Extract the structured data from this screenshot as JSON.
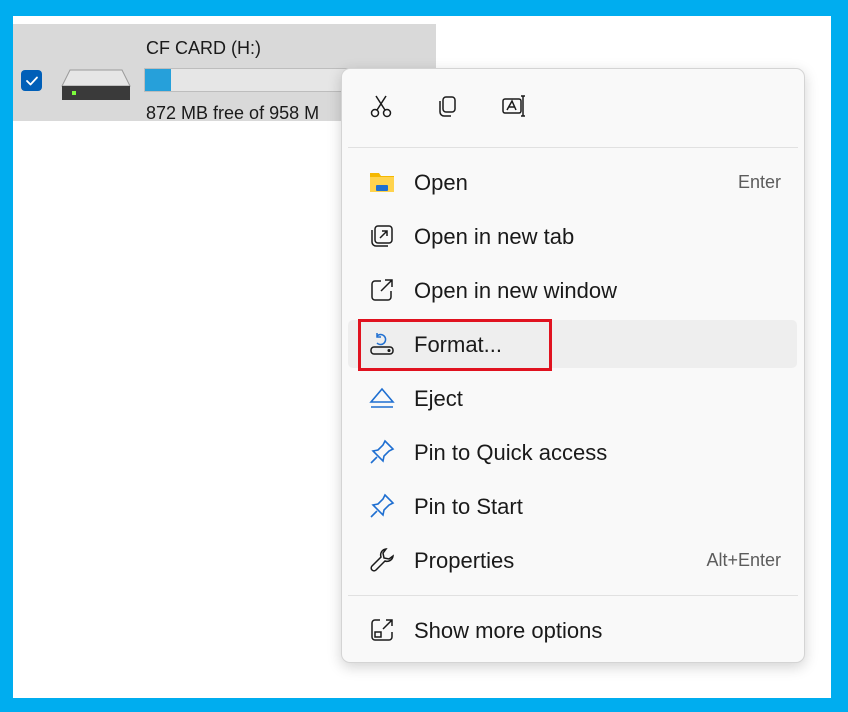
{
  "drive": {
    "name": "CF CARD (H:)",
    "free_text": "872 MB free of 958 M",
    "used_fraction": 0.09,
    "selected": true
  },
  "menu": {
    "quick_actions": [
      "cut-icon",
      "copy-icon",
      "rename-icon"
    ],
    "items": [
      {
        "label": "Open",
        "shortcut": "Enter",
        "icon": "folder-icon"
      },
      {
        "label": "Open in new tab",
        "shortcut": "",
        "icon": "open-new-tab-icon"
      },
      {
        "label": "Open in new window",
        "shortcut": "",
        "icon": "open-new-window-icon"
      },
      {
        "label": "Format...",
        "shortcut": "",
        "icon": "format-drive-icon",
        "hovered": true
      },
      {
        "label": "Eject",
        "shortcut": "",
        "icon": "eject-icon"
      },
      {
        "label": "Pin to Quick access",
        "shortcut": "",
        "icon": "pin-icon"
      },
      {
        "label": "Pin to Start",
        "shortcut": "",
        "icon": "pin-icon"
      },
      {
        "label": "Properties",
        "shortcut": "Alt+Enter",
        "icon": "wrench-icon"
      }
    ],
    "more_options": {
      "label": "Show more options",
      "icon": "show-more-icon"
    }
  },
  "colors": {
    "frame": "#00adef",
    "highlight": "#e0121f",
    "accent": "#005fb8",
    "capacity_fill": "#26a0da"
  }
}
